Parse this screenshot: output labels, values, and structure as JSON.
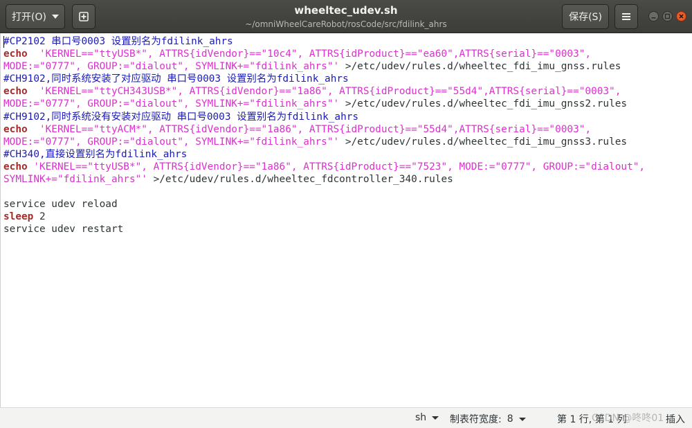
{
  "window": {
    "title": "wheeltec_udev.sh",
    "path": "~/omniWheelCareRobot/rosCode/src/fdilink_ahrs"
  },
  "toolbar": {
    "open_label": "打开(O)",
    "save_label": "保存(S)"
  },
  "editor": {
    "language": "sh",
    "lines": [
      [
        {
          "t": "#CP2102 串口号0003 设置别名为fdilink_ahrs",
          "c": "cm"
        }
      ],
      [
        {
          "t": "echo",
          "c": "kw"
        },
        {
          "t": "  ",
          "c": ""
        },
        {
          "t": "'KERNEL==\"ttyUSB*\", ATTRS{idVendor}==\"10c4\", ATTRS{idProduct}==\"ea60\",ATTRS{serial}==\"0003\",",
          "c": "str"
        }
      ],
      [
        {
          "t": "MODE:=\"0777\", GROUP:=\"dialout\", SYMLINK+=\"fdilink_ahrs\"'",
          "c": "str"
        },
        {
          "t": " >/etc/udev/rules.d/wheeltec_fdi_imu_gnss.rules",
          "c": ""
        }
      ],
      [
        {
          "t": "#CH9102,同时系统安装了对应驱动 串口号0003 设置别名为fdilink_ahrs",
          "c": "cm"
        }
      ],
      [
        {
          "t": "echo",
          "c": "kw"
        },
        {
          "t": "  ",
          "c": ""
        },
        {
          "t": "'KERNEL==\"ttyCH343USB*\", ATTRS{idVendor}==\"1a86\", ATTRS{idProduct}==\"55d4\",ATTRS{serial}==\"0003\",",
          "c": "str"
        }
      ],
      [
        {
          "t": "MODE:=\"0777\", GROUP:=\"dialout\", SYMLINK+=\"fdilink_ahrs\"'",
          "c": "str"
        },
        {
          "t": " >/etc/udev/rules.d/wheeltec_fdi_imu_gnss2.rules",
          "c": ""
        }
      ],
      [
        {
          "t": "#CH9102,同时系统没有安装对应驱动 串口号0003 设置别名为fdilink_ahrs",
          "c": "cm"
        }
      ],
      [
        {
          "t": "echo",
          "c": "kw"
        },
        {
          "t": "  ",
          "c": ""
        },
        {
          "t": "'KERNEL==\"ttyACM*\", ATTRS{idVendor}==\"1a86\", ATTRS{idProduct}==\"55d4\",ATTRS{serial}==\"0003\",",
          "c": "str"
        }
      ],
      [
        {
          "t": "MODE:=\"0777\", GROUP:=\"dialout\", SYMLINK+=\"fdilink_ahrs\"'",
          "c": "str"
        },
        {
          "t": " >/etc/udev/rules.d/wheeltec_fdi_imu_gnss3.rules",
          "c": ""
        }
      ],
      [
        {
          "t": "#CH340,直接设置别名为fdilink_ahrs",
          "c": "cm"
        }
      ],
      [
        {
          "t": "echo",
          "c": "kw"
        },
        {
          "t": " ",
          "c": ""
        },
        {
          "t": "'KERNEL==\"ttyUSB*\", ATTRS{idVendor}==\"1a86\", ATTRS{idProduct}==\"7523\", MODE:=\"0777\", GROUP:=\"dialout\",",
          "c": "str"
        }
      ],
      [
        {
          "t": "SYMLINK+=\"fdilink_ahrs\"'",
          "c": "str"
        },
        {
          "t": " >/etc/udev/rules.d/wheeltec_fdcontroller_340.rules",
          "c": ""
        }
      ],
      [],
      [
        {
          "t": "service udev reload",
          "c": ""
        }
      ],
      [
        {
          "t": "sleep",
          "c": "kw"
        },
        {
          "t": " 2",
          "c": ""
        }
      ],
      [
        {
          "t": "service udev restart",
          "c": ""
        }
      ]
    ]
  },
  "statusbar": {
    "language": "sh",
    "tab_width_label": "制表符宽度:",
    "tab_width": "8",
    "position": "第 1 行, 第 1 列",
    "insert_mode": "插入",
    "watermark": "CSDN @咚咚01"
  },
  "colors": {
    "comment": "#1a1ab8",
    "keyword": "#a52a2a",
    "string": "#dd2fcf",
    "headerbar": "#3c3c39"
  }
}
